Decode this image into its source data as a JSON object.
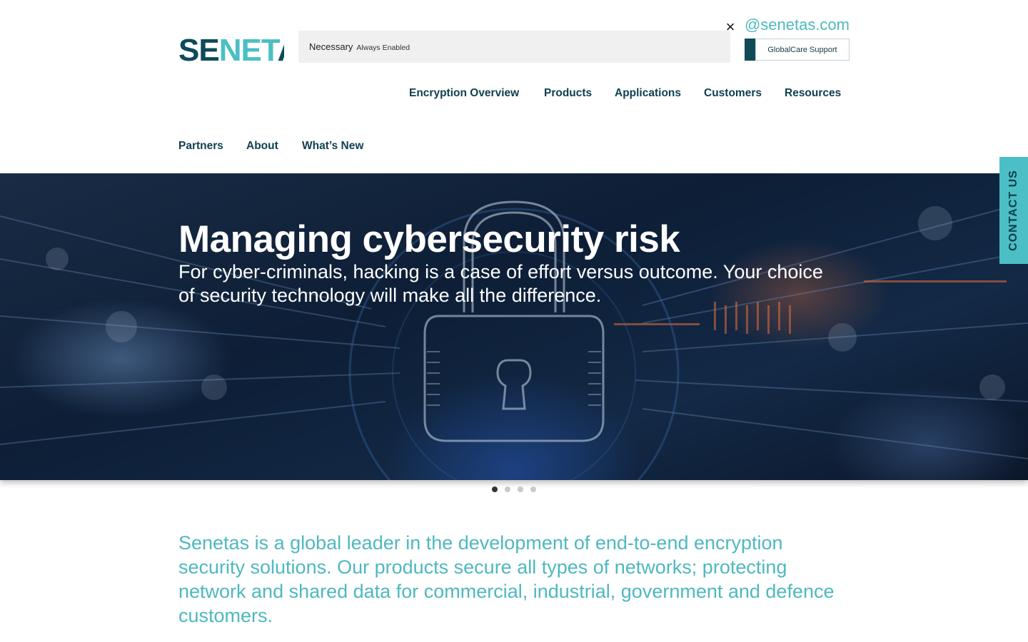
{
  "brand": {
    "logo_dark": "SE",
    "logo_light": "NET",
    "logo_dark_2": "A",
    "colors": {
      "teal": "#4bbfc5",
      "navy": "#0e4a5a",
      "cookie_bg": "#f0f0f0"
    }
  },
  "header": {
    "email_fragment": "@senetas.com",
    "support_label": "GlobalCare Support"
  },
  "nav": {
    "primary": [
      "Encryption Overview",
      "Products",
      "Applications",
      "Customers",
      "Resources"
    ],
    "secondary": [
      "Partners",
      "About",
      "What’s New"
    ]
  },
  "cookie": {
    "category": "Necessary",
    "status": "Always Enabled",
    "close_icon": "×"
  },
  "hero": {
    "title": "Managing cybersecurity risk",
    "subtitle": "For cyber-criminals, hacking is a case of effort versus outcome. Your choice of security technology will make all the difference.",
    "image_icon": "padlock-icon"
  },
  "contact_tab": {
    "label": "CONTACT US"
  },
  "carousel": {
    "total_slides": 4,
    "active_index": 0
  },
  "intro": {
    "text": "Senetas is a global leader in the development of end-to-end encryption security solutions. Our products secure all types of networks; protecting network and shared data for commercial, industrial, government and defence customers."
  }
}
